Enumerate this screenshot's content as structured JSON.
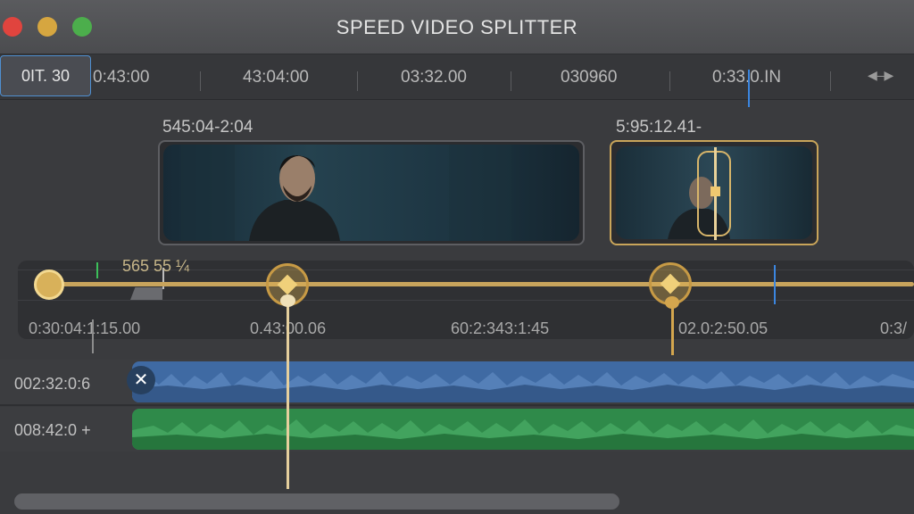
{
  "window": {
    "title": "SPEED VIDEO SPLITTER"
  },
  "ruler": {
    "current_timecode": "0IT. 30",
    "labels": [
      "0:43:00",
      "43:04:00",
      "03:32.00",
      "030960",
      "0:33.0.IN"
    ]
  },
  "clips": [
    {
      "label": "545:04-2:04"
    },
    {
      "label": "5:95:12.41-"
    }
  ],
  "speed_timeline": {
    "speed_label": "565 55 ¼",
    "time_labels": [
      "0:30:04:1:15.00",
      "0.43:00.06",
      "60:2:343:1:45",
      "02.0:2:50.05",
      "0:3/"
    ]
  },
  "tracks": [
    {
      "name": "002:32:0:6",
      "color": "#3f6aa3"
    },
    {
      "name": "008:42:0 +",
      "color": "#2f8a4a"
    }
  ],
  "colors": {
    "accent_gold": "#c8a45c",
    "playhead": "#e5cf9d",
    "marker_blue": "#3b86e0"
  }
}
